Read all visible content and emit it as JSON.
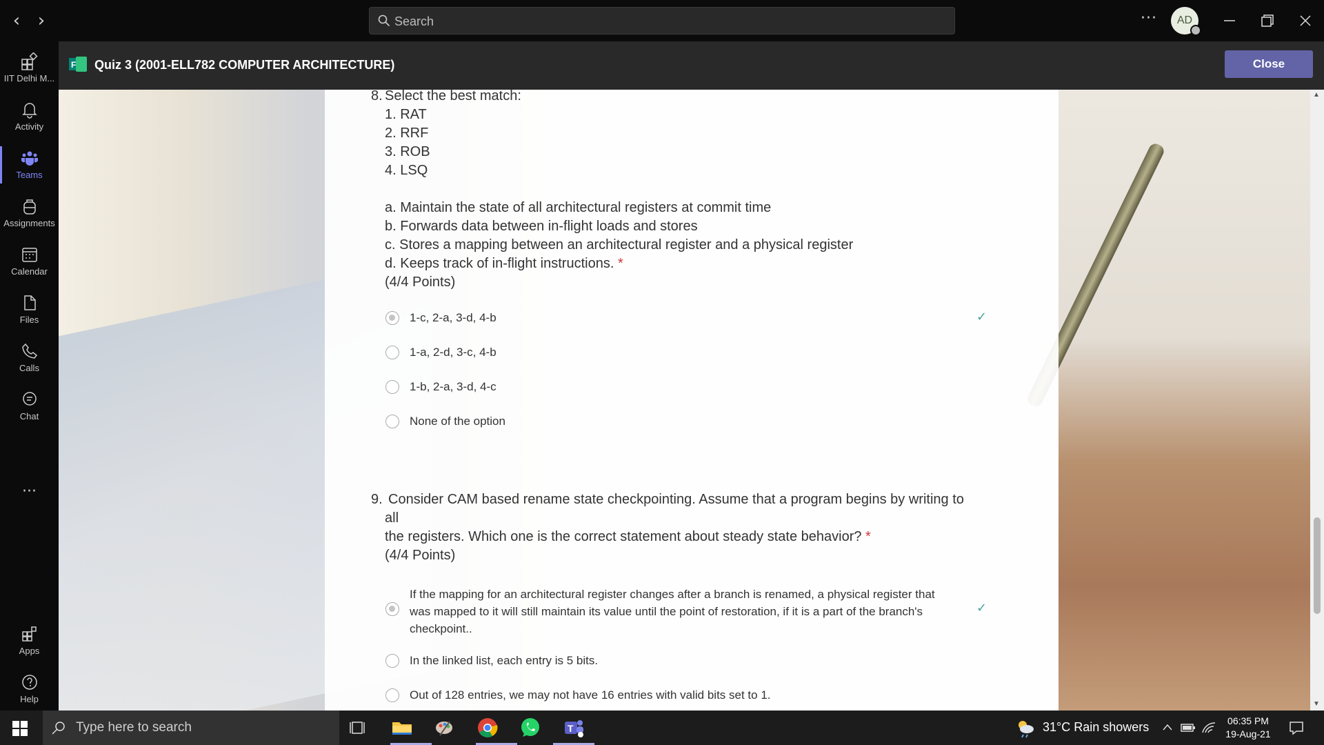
{
  "search": {
    "placeholder": "Search"
  },
  "user": {
    "initials": "AD"
  },
  "rail": [
    {
      "label": "IIT Delhi M..."
    },
    {
      "label": "Activity"
    },
    {
      "label": "Teams"
    },
    {
      "label": "Assignments"
    },
    {
      "label": "Calendar"
    },
    {
      "label": "Files"
    },
    {
      "label": "Calls"
    },
    {
      "label": "Chat"
    },
    {
      "label": "Apps"
    },
    {
      "label": "Help"
    }
  ],
  "app": {
    "title": "Quiz 3 (2001-ELL782 COMPUTER ARCHITECTURE)",
    "close_label": "Close"
  },
  "q8": {
    "number": "8.",
    "title": "Select the best match:",
    "items": [
      "1. RAT",
      "2. RRF",
      "3. ROB",
      "4. LSQ"
    ],
    "defs": [
      "a. Maintain the state of all architectural registers at commit time",
      "b. Forwards data between in-flight loads and stores",
      "c. Stores a mapping between an architectural register and a physical register",
      "d. Keeps track of in-flight instructions."
    ],
    "required": "*",
    "points": "(4/4 Points)",
    "options": [
      {
        "label": "1-c, 2-a, 3-d, 4-b",
        "selected": true,
        "correct": true
      },
      {
        "label": "1-a, 2-d, 3-c, 4-b",
        "selected": false
      },
      {
        "label": "1-b, 2-a, 3-d, 4-c",
        "selected": false
      },
      {
        "label": "None of the option",
        "selected": false
      }
    ]
  },
  "q9": {
    "number": "9.",
    "title_line1": "Consider CAM based rename state checkpointing. Assume that a program begins by writing to",
    "title_line2": "all",
    "title_line3": "the registers. Which one is the correct statement about steady state behavior?",
    "required": "*",
    "points": "(4/4 Points)",
    "options": [
      {
        "line1": "If the mapping for an architectural register changes after a branch is renamed, a physical register that",
        "line2": "was mapped to it will still maintain its value until the point of restoration, if it is a part of the branch's",
        "line3": "checkpoint..",
        "selected": true,
        "correct": true
      },
      {
        "label": "In the linked list, each entry is 5 bits.",
        "selected": false
      },
      {
        "label": "Out of 128 entries, we may not have 16 entries with valid bits set to 1.",
        "selected": false
      }
    ]
  },
  "taskbar": {
    "search_placeholder": "Type here to search",
    "weather": "31°C  Rain showers",
    "time": "06:35 PM",
    "date": "19-Aug-21"
  }
}
